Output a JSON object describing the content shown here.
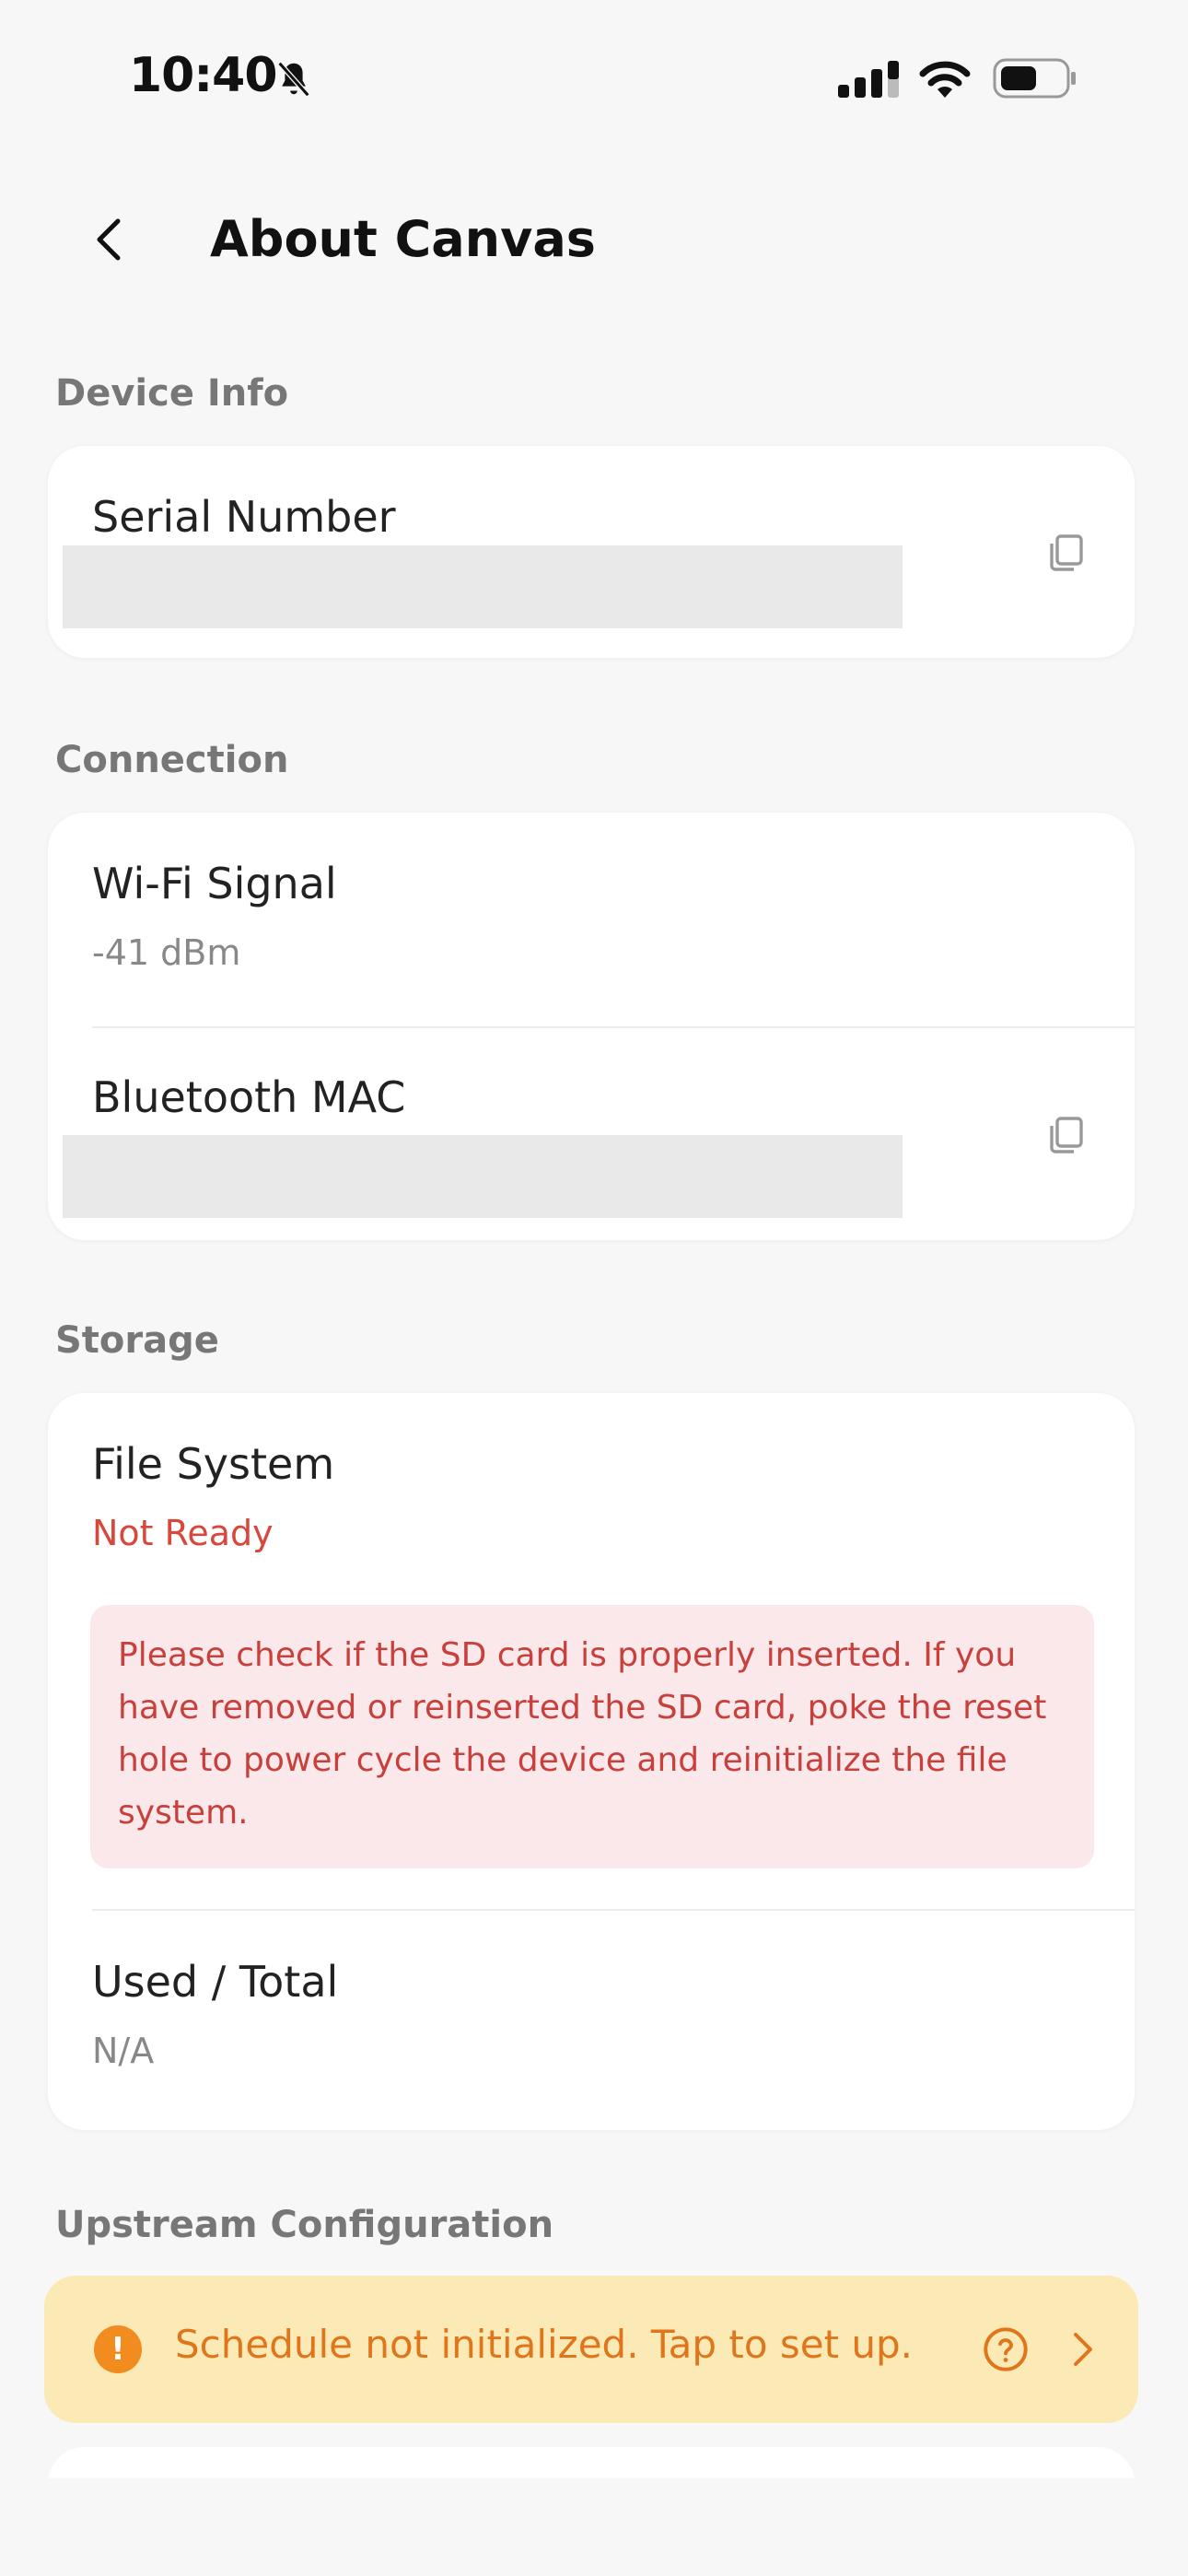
{
  "status_bar": {
    "time": "10:40"
  },
  "header": {
    "title": "About Canvas"
  },
  "sections": {
    "device_info": {
      "title": "Device Info",
      "serial_number_label": "Serial Number"
    },
    "connection": {
      "title": "Connection",
      "wifi_label": "Wi-Fi Signal",
      "wifi_value": "-41 dBm",
      "bluetooth_label": "Bluetooth MAC"
    },
    "storage": {
      "title": "Storage",
      "file_system_label": "File System",
      "file_system_status": "Not Ready",
      "alert_message": "Please check if the SD card is properly inserted. If you have removed or reinserted the SD card, poke the reset hole to power cycle the device and reinitialize the file system.",
      "used_total_label": "Used / Total",
      "used_total_value": "N/A"
    },
    "upstream": {
      "title": "Upstream Configuration",
      "banner_icon": "!",
      "banner_text": "Schedule not initialized. Tap to set up."
    }
  },
  "colors": {
    "accent_red": "#d9463b",
    "warning_orange": "#e0761c",
    "warning_bg": "#fbeab5",
    "alert_bg": "#fbe8ea"
  },
  "icons": [
    "bell-slash-icon",
    "signal-icon",
    "wifi-icon",
    "battery-icon",
    "back-icon",
    "copy-icon",
    "warning-icon",
    "help-icon",
    "chevron-right-icon"
  ]
}
